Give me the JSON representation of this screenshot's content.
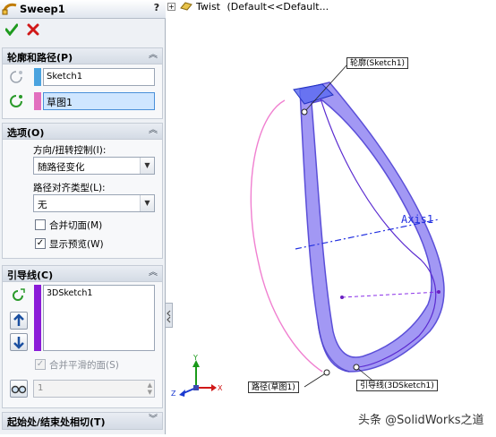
{
  "header": {
    "title": "Sweep1",
    "help": "?"
  },
  "actions": {
    "ok": "check-icon",
    "cancel": "x-icon"
  },
  "profile_path": {
    "title": "轮廓和路径(P)",
    "profile_value": "Sketch1",
    "path_value": "草图1",
    "profile_color": "#4aa3df",
    "path_color": "#e26fbf"
  },
  "options": {
    "title": "选项(O)",
    "orientation_label": "方向/扭转控制(I):",
    "orientation_value": "随路径变化",
    "alignment_label": "路径对齐类型(L):",
    "alignment_value": "无",
    "merge_tangent_label": "合并切面(M)",
    "merge_tangent_checked": false,
    "show_preview_label": "显示预览(W)",
    "show_preview_checked": true
  },
  "guides": {
    "title": "引导线(C)",
    "items": [
      "3DSketch1"
    ],
    "item_color": "#8a1bd8",
    "merge_smooth_label": "合并平滑的面(S)",
    "merge_smooth_checked": true,
    "spin_value": "1"
  },
  "start_end": {
    "title": "起始处/结束处相切(T)"
  },
  "tree": {
    "feature": "Twist",
    "config": "(Default<<Default..."
  },
  "viewport": {
    "callout_profile": "轮廓(Sketch1)",
    "callout_axis": "Axis1",
    "callout_path": "路径(草图1)",
    "callout_guide": "引导线(3DSketch1)",
    "triad": {
      "y": "Y",
      "z": "Z",
      "x": "X"
    }
  },
  "watermark": "头条 @SolidWorks之道"
}
